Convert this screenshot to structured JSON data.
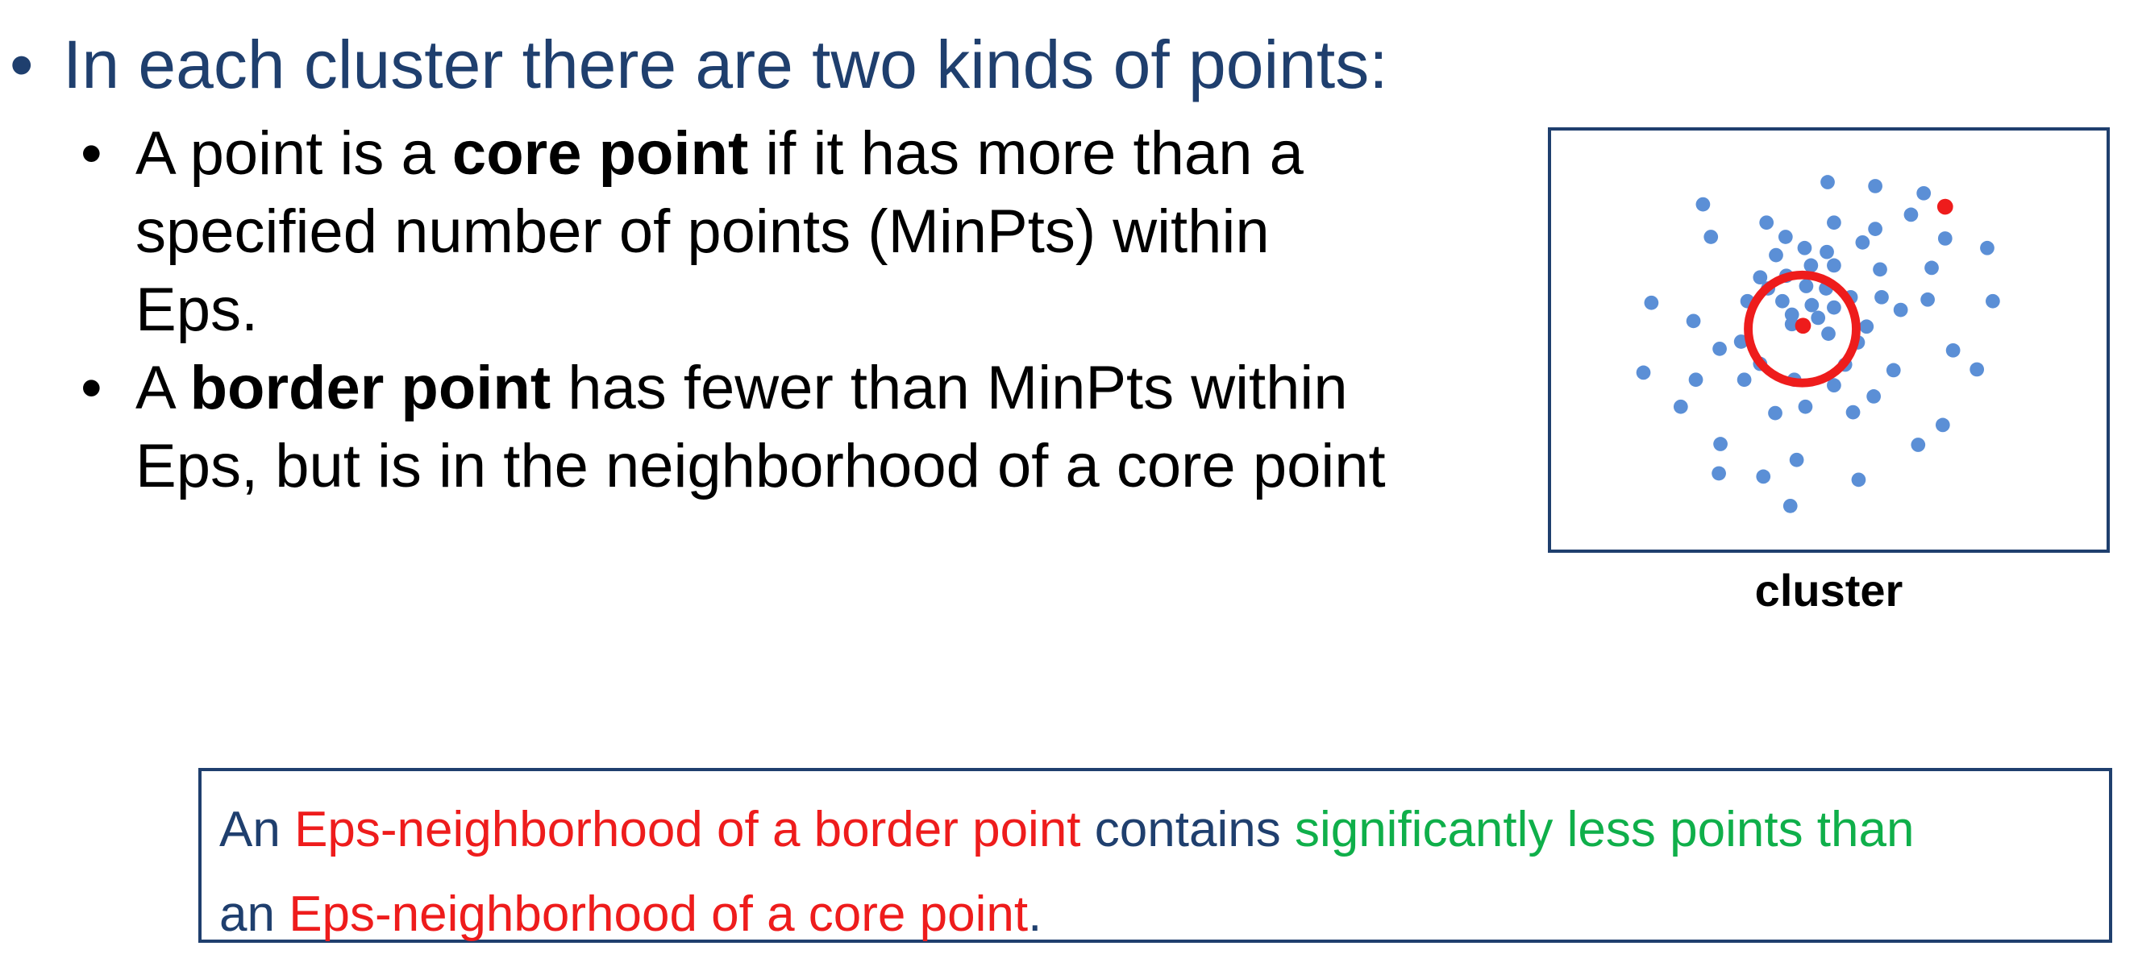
{
  "main_bullet": {
    "marker": "•",
    "text": "In each cluster there are two kinds of points:"
  },
  "sub_bullets": [
    {
      "marker": "•",
      "prefix": "A point is a ",
      "bold": "core point",
      "suffix_line1": " if it has more than a",
      "line2": "specified  number of points (MinPts) within",
      "line3": "Eps."
    },
    {
      "marker": "•",
      "prefix": "A ",
      "bold": "border point",
      "suffix_line1": " has fewer than MinPts within",
      "line2": "Eps, but is in  the neighborhood of a core point"
    }
  ],
  "diagram": {
    "caption": "cluster",
    "point_color": "#5b8fd6",
    "highlight_color": "#ee1c1c"
  },
  "definition": {
    "line1_a": "An  ",
    "line1_b": "Eps-neighborhood of a border point",
    "line1_c": " contains ",
    "line1_d": "significantly less points than",
    "line2_a": "an  ",
    "line2_b": "Eps-neighborhood of a core point",
    "line2_c": "."
  },
  "colors": {
    "title_blue": "#1f3f6e",
    "red": "#ee1c1c",
    "green": "#0faf4a"
  }
}
